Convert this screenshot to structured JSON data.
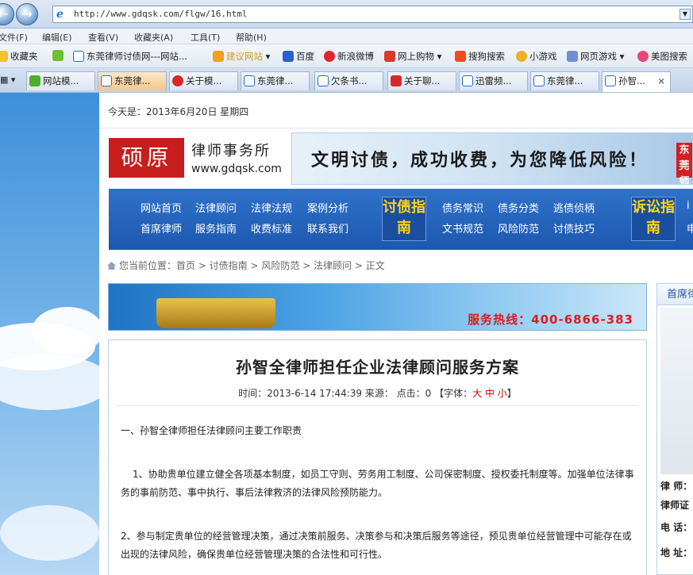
{
  "browser": {
    "address_url": "http://www.gdqsk.com/flgw/16.html",
    "menu": [
      "文件(F)",
      "编辑(E)",
      "查看(V)",
      "收藏夹(A)",
      "工具(T)",
      "帮助(H)"
    ],
    "favorites": [
      "收藏夹",
      "东莞律师讨债网---网站...",
      "建议网站",
      "百度",
      "新浪微博",
      "网上购物",
      "搜狗搜索",
      "小游戏",
      "网页游戏",
      "美图搜索"
    ],
    "tabs": [
      "网站模...",
      "东莞律...",
      "关于模...",
      "东莞律...",
      "欠条书...",
      "关于聊...",
      "迅雷频...",
      "东莞律...",
      "孙智..."
    ],
    "close_symbol": "×"
  },
  "site": {
    "date": "今天是：2013年6月20日 星期四",
    "logo_seal": "硕原",
    "logo_name": "律师事务所",
    "logo_domain": "www.gdqsk.com",
    "slogan": "文明讨债，成功收费，为您降低风险！",
    "slogan_side": "东莞 师",
    "nav_row1": [
      "网站首页",
      "法律顾问",
      "法律法规",
      "案例分析"
    ],
    "nav_row2": [
      "首席律师",
      "服务指南",
      "收费标准",
      "联系我们"
    ],
    "btn_debt": "讨债指南",
    "nav_row3": [
      "债务常识",
      "债务分类",
      "逃债侦柄"
    ],
    "nav_row4": [
      "文书规范",
      "风险防范",
      "讨债技巧"
    ],
    "btn_litigation": "诉讼指南",
    "nav_edge1": "i",
    "nav_edge2": "申",
    "breadcrumb": "您当前位置：首页 > 讨债指南 > 风险防范 > 法律顾问 > 正文",
    "hotline": "服务热线：400-6866-383"
  },
  "article": {
    "title": "孙智全律师担任企业法律顾问服务方案",
    "meta_time": "时间：2013-6-14 17:44:39  来源：   点击：0  【字体：",
    "meta_font": "大 中 小",
    "meta_end": "】",
    "p1": "一、孙智全律师担任法律顾问主要工作职责",
    "p2": "1、协助贵单位建立健全各项基本制度，如员工守则、劳务用工制度、公司保密制度、授权委托制度等。加强单位法律事务的事前防范、事中执行、事后法律救济的法律风险预防能力。",
    "p3": "2、参与制定贵单位的经营管理决策，通过决策前服务、决策参与和决策后服务等途径，预见贵单位经营管理中可能存在或出现的法律风险，确保贵单位经营管理决策的合法性和可行性。"
  },
  "sidebar": {
    "header": "首席律",
    "rows": [
      "律 师：",
      "律师证",
      "电 话：",
      "地 址："
    ]
  }
}
